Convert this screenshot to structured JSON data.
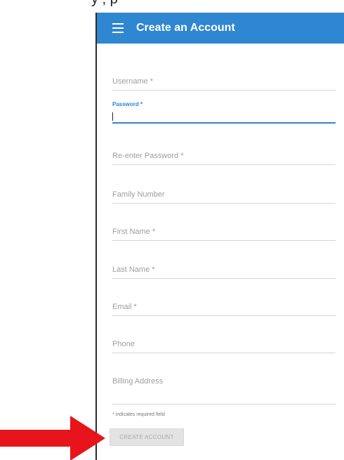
{
  "header": {
    "title": "Create an Account",
    "menu_icon": "hamburger-menu-icon",
    "background_color": "#2f86d1"
  },
  "fields": [
    {
      "label": "Username *",
      "active": false
    },
    {
      "label": "Password *",
      "active": true
    },
    {
      "label": "Re-enter Password *",
      "active": false
    },
    {
      "label": "Family Number",
      "active": false
    },
    {
      "label": "First Name *",
      "active": false
    },
    {
      "label": "Last Name *",
      "active": false
    },
    {
      "label": "Email *",
      "active": false
    },
    {
      "label": "Phone",
      "active": false
    },
    {
      "label": "Billing Address",
      "active": false
    }
  ],
  "required_note": "* indicates required field",
  "create_button": {
    "label": "CREATE ACCOUNT",
    "state": "disabled"
  },
  "colors": {
    "accent": "#2f86d1",
    "annotation_arrow": "#e8141b"
  }
}
